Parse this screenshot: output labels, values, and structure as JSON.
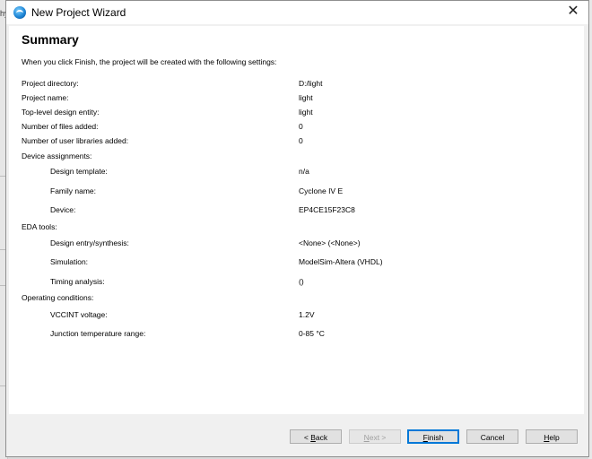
{
  "window": {
    "title": "New Project Wizard",
    "close_glyph": "✕"
  },
  "summary": {
    "heading": "Summary",
    "intro": "When you click Finish, the project will be created with the following settings:",
    "rows": [
      {
        "label": "Project directory:",
        "value": "D:/light"
      },
      {
        "label": "Project name:",
        "value": "light"
      },
      {
        "label": "Top-level design entity:",
        "value": "light"
      },
      {
        "label": "Number of files added:",
        "value": "0"
      },
      {
        "label": "Number of user libraries added:",
        "value": "0"
      },
      {
        "label": "Device assignments:",
        "value": ""
      },
      {
        "label": "Design template:",
        "value": "n/a"
      },
      {
        "label": "Family name:",
        "value": "Cyclone IV E"
      },
      {
        "label": "Device:",
        "value": "EP4CE15F23C8"
      },
      {
        "label": "EDA tools:",
        "value": ""
      },
      {
        "label": "Design entry/synthesis:",
        "value": "<None> (<None>)"
      },
      {
        "label": "Simulation:",
        "value": "ModelSim-Altera (VHDL)"
      },
      {
        "label": "Timing analysis:",
        "value": " ()"
      },
      {
        "label": "Operating conditions:",
        "value": ""
      },
      {
        "label": "VCCINT voltage:",
        "value": "1.2V"
      },
      {
        "label": "Junction temperature range:",
        "value": "0-85 °C"
      }
    ]
  },
  "buttons": {
    "back": {
      "prefix": "< ",
      "mnemonic": "B",
      "rest": "ack"
    },
    "next": {
      "mnemonic": "N",
      "rest": "ext >"
    },
    "finish": {
      "mnemonic": "F",
      "rest": "inish"
    },
    "cancel": "Cancel",
    "help": {
      "mnemonic": "H",
      "rest": "elp"
    }
  },
  "background": {
    "title_fragment": "hy"
  },
  "colors": {
    "default_button_border": "#0078d7",
    "disabled_text": "#a0a0a0"
  }
}
